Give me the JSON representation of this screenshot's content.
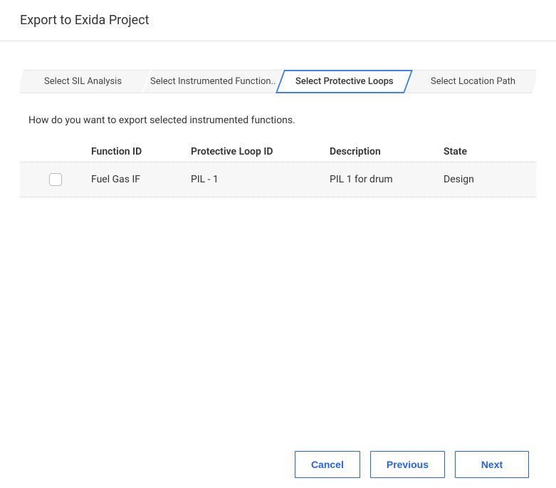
{
  "header": {
    "title": "Export to Exida Project"
  },
  "steps": [
    {
      "label": "Select SIL Analysis",
      "active": false
    },
    {
      "label": "Select Instrumented Function..",
      "active": false
    },
    {
      "label": "Select Protective Loops",
      "active": true
    },
    {
      "label": "Select Location Path",
      "active": false
    }
  ],
  "prompt": "How do you want to export selected instrumented functions.",
  "table": {
    "headers": {
      "function_id": "Function ID",
      "protective_loop_id": "Protective Loop ID",
      "description": "Description",
      "state": "State"
    },
    "rows": [
      {
        "checked": false,
        "function_id": "Fuel Gas IF",
        "protective_loop_id": "PIL - 1",
        "description": "PIL 1 for drum",
        "state": "Design"
      }
    ]
  },
  "footer": {
    "cancel": "Cancel",
    "previous": "Previous",
    "next": "Next"
  }
}
